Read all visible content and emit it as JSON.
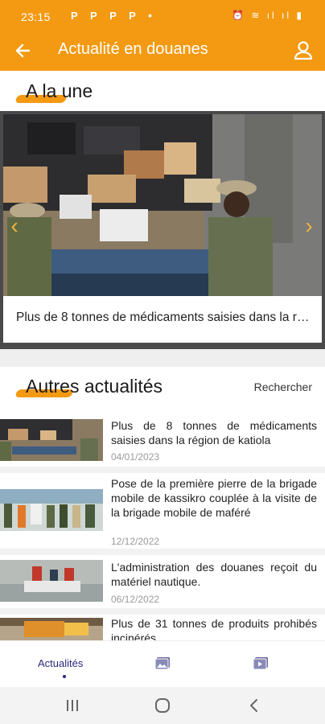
{
  "status_bar": {
    "time": "23:15",
    "notifications": "P P P P •",
    "system_icons": "⏰ ≋ ıl ıl ▮"
  },
  "app_bar": {
    "title": "Actualité en douanes",
    "back_icon": "arrow-left-icon",
    "profile_icon": "user-icon"
  },
  "featured": {
    "heading": "A la une",
    "caption": "Plus de 8 tonnes de médicaments saisies dans la région de katiola"
  },
  "others": {
    "heading": "Autres actualités",
    "search_label": "Rechercher",
    "items": [
      {
        "title": "Plus de 8 tonnes de médicaments saisies dans la région de katiola",
        "date": "04/01/2023"
      },
      {
        "title": "Pose de la première pierre de la brigade mobile de kassikro couplée à la visite de la brigade mobile de maféré",
        "date": "12/12/2022"
      },
      {
        "title": "L'administration des douanes reçoit du matériel nautique.",
        "date": "06/12/2022"
      },
      {
        "title": "Plus de 31 tonnes de produits prohibés incinérés",
        "date": ""
      }
    ]
  },
  "bottom_nav": {
    "items": [
      {
        "label": "Actualités",
        "icon": "news-icon",
        "active": true
      },
      {
        "label": "",
        "icon": "photo-gallery-icon",
        "active": false
      },
      {
        "label": "",
        "icon": "video-icon",
        "active": false
      }
    ]
  },
  "colors": {
    "brand_orange": "#f39a12",
    "nav_active": "#2a2a7c"
  }
}
